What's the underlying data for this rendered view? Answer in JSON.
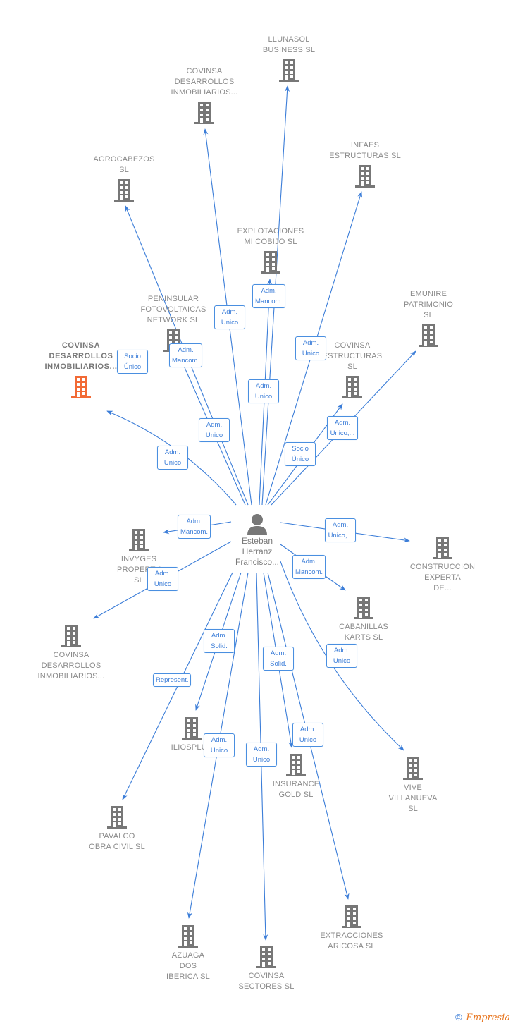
{
  "colors": {
    "edge": "#3b7dd8",
    "node_icon": "#777777",
    "highlight_icon": "#f26a35",
    "label_text": "#8a8a8a"
  },
  "center": {
    "name": "Esteban\nHerranz\nFrancisco...",
    "icon": "person-icon"
  },
  "nodes": [
    {
      "id": "llunasol",
      "label": "LLUNASOL\nBUSINESS  SL",
      "icon": "building-icon"
    },
    {
      "id": "covinsa-des-1",
      "label": "COVINSA\nDESARROLLOS\nINMOBILIARIOS...",
      "icon": "building-icon"
    },
    {
      "id": "agrocabezos",
      "label": "AGROCABEZOS\nSL",
      "icon": "building-icon"
    },
    {
      "id": "infaes",
      "label": "INFAES\nESTRUCTURAS SL",
      "icon": "building-icon"
    },
    {
      "id": "explotaciones",
      "label": "EXPLOTACIONES\nMI COBIJO  SL",
      "icon": "building-icon"
    },
    {
      "id": "peninsular",
      "label": "PENINSULAR\nFOTOVOLTAICAS\nNETWORK  SL",
      "icon": "building-icon"
    },
    {
      "id": "emunire",
      "label": "EMUNIRE\nPATRIMONIO\nSL",
      "icon": "building-icon"
    },
    {
      "id": "covinsa-des-main",
      "label": "COVINSA\nDESARROLLOS\nINMOBILIARIOS...",
      "icon": "building-icon",
      "highlight": true
    },
    {
      "id": "covinsa-estructuras",
      "label": "COVINSA\nESTRUCTURAS\nSL",
      "icon": "building-icon"
    },
    {
      "id": "invyges",
      "label": "INVYGES\nPROPERTY\nSL",
      "icon": "building-icon"
    },
    {
      "id": "construccion",
      "label": "CONSTRUCCION\nEXPERTA\nDE...",
      "icon": "building-icon"
    },
    {
      "id": "cabanillas",
      "label": "CABANILLAS\nKARTS  SL",
      "icon": "building-icon"
    },
    {
      "id": "covinsa-des-2",
      "label": "COVINSA\nDESARROLLOS\nINMOBILIARIOS...",
      "icon": "building-icon"
    },
    {
      "id": "iliosplus",
      "label": "ILIOSPLUS",
      "icon": "building-icon"
    },
    {
      "id": "insurance",
      "label": "INSURANCE\nGOLD  SL",
      "icon": "building-icon"
    },
    {
      "id": "vive",
      "label": "VIVE\nVILLANUEVA\nSL",
      "icon": "building-icon"
    },
    {
      "id": "pavalco",
      "label": "PAVALCO\nOBRA CIVIL  SL",
      "icon": "building-icon"
    },
    {
      "id": "azuaga",
      "label": "AZUAGA\nDOS\nIBERICA  SL",
      "icon": "building-icon"
    },
    {
      "id": "covinsa-sectores",
      "label": "COVINSA\nSECTORES  SL",
      "icon": "building-icon"
    },
    {
      "id": "extracciones",
      "label": "EXTRACCIONES\nARICOSA  SL",
      "icon": "building-icon"
    }
  ],
  "edges": [
    {
      "to": "llunasol",
      "label": "Adm.\nMancom."
    },
    {
      "to": "covinsa-des-1",
      "label": "Adm.\nUnico"
    },
    {
      "to": "agrocabezos",
      "label": "Adm.\nUnico"
    },
    {
      "to": "infaes",
      "label": "Adm.\nUnico"
    },
    {
      "to": "explotaciones",
      "label": "Adm.\nUnico"
    },
    {
      "to": "peninsular",
      "label": "Adm.\nMancom."
    },
    {
      "to": "emunire",
      "label": "Socio\nÚnico"
    },
    {
      "to": "covinsa-des-main",
      "label": "Adm.\nUnico"
    },
    {
      "to": "covinsa-des-main",
      "label": "Socio\nÚnico"
    },
    {
      "to": "covinsa-estructuras",
      "label": "Adm.\nUnico,..."
    },
    {
      "to": "invyges",
      "label": "Adm.\nMancom."
    },
    {
      "to": "construccion",
      "label": "Adm.\nUnico,..."
    },
    {
      "to": "cabanillas",
      "label": "Adm.\nMancom."
    },
    {
      "to": "covinsa-des-2",
      "label": "Adm.\nUnico"
    },
    {
      "to": "iliosplus",
      "label": "Adm.\nSolid."
    },
    {
      "to": "insurance",
      "label": "Adm.\nSolid."
    },
    {
      "to": "vive",
      "label": "Adm.\nUnico"
    },
    {
      "to": "pavalco",
      "label": "Represent."
    },
    {
      "to": "azuaga",
      "label": "Adm.\nUnico"
    },
    {
      "to": "covinsa-sectores",
      "label": "Adm.\nUnico"
    },
    {
      "to": "extracciones",
      "label": "Adm.\nUnico"
    }
  ],
  "footer": {
    "copyright": "©",
    "brand": "Empresia"
  }
}
